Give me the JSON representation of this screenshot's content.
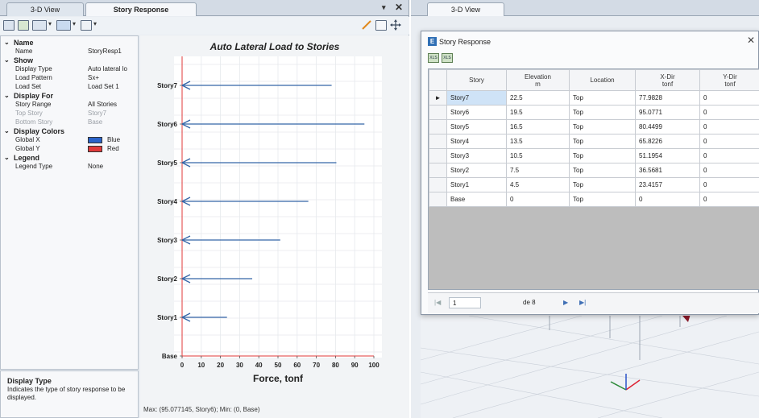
{
  "left_tabs": [
    "3-D View",
    "Story Response"
  ],
  "left_tab_ctl": [
    "▾",
    "✕"
  ],
  "right_tabs": [
    "3-D View"
  ],
  "props": {
    "name_cat": "Name",
    "name_key": "Name",
    "name_val": "StoryResp1",
    "show_cat": "Show",
    "display_type_key": "Display Type",
    "display_type_val": "Auto lateral lo",
    "load_pattern_key": "Load Pattern",
    "load_pattern_val": "Sx+",
    "load_set_key": "Load Set",
    "load_set_val": "Load Set 1",
    "display_for_cat": "Display For",
    "story_range_key": "Story Range",
    "story_range_val": "All Stories",
    "top_story_key": "Top Story",
    "top_story_val": "Story7",
    "bottom_story_key": "Bottom Story",
    "bottom_story_val": "Base",
    "display_colors_cat": "Display Colors",
    "global_x_key": "Global X",
    "global_x_val": "Blue",
    "global_x_color": "#2a63c9",
    "global_y_key": "Global Y",
    "global_y_val": "Red",
    "global_y_color": "#e03a3a",
    "legend_cat": "Legend",
    "legend_type_key": "Legend Type",
    "legend_type_val": "None"
  },
  "desc": {
    "title": "Display Type",
    "text": "Indicates the type of story response to be displayed."
  },
  "chart_data": {
    "type": "bar",
    "orientation": "horizontal",
    "title": "Auto Lateral Load to Stories",
    "xlabel": "Force, tonf",
    "ylabel": "",
    "categories": [
      "Base",
      "Story1",
      "Story2",
      "Story3",
      "Story4",
      "Story5",
      "Story6",
      "Story7"
    ],
    "values": [
      0,
      23.4157,
      36.5681,
      51.1954,
      65.8226,
      80.4499,
      95.0771,
      77.9828
    ],
    "xlim": [
      0,
      100
    ],
    "xticks": [
      "0",
      "10",
      "20",
      "30",
      "40",
      "50",
      "60",
      "70",
      "80",
      "90",
      "100"
    ],
    "grid": true,
    "series_color": "#3566a8",
    "axis_color": "#e03a3a",
    "status": "Max: (95.077145, Story6);   Min: (0, Base)"
  },
  "popup": {
    "title": "Story Response",
    "logo": "E",
    "close": "✕",
    "export_icons": [
      "XLS",
      "XLS"
    ],
    "columns": [
      {
        "line1": "Story",
        "line2": ""
      },
      {
        "line1": "Elevation",
        "line2": "m"
      },
      {
        "line1": "Location",
        "line2": ""
      },
      {
        "line1": "X-Dir",
        "line2": "tonf"
      },
      {
        "line1": "Y-Dir",
        "line2": "tonf"
      }
    ],
    "rows": [
      [
        "Story7",
        "22.5",
        "Top",
        "77.9828",
        "0"
      ],
      [
        "Story6",
        "19.5",
        "Top",
        "95.0771",
        "0"
      ],
      [
        "Story5",
        "16.5",
        "Top",
        "80.4499",
        "0"
      ],
      [
        "Story4",
        "13.5",
        "Top",
        "65.8226",
        "0"
      ],
      [
        "Story3",
        "10.5",
        "Top",
        "51.1954",
        "0"
      ],
      [
        "Story2",
        "7.5",
        "Top",
        "36.5681",
        "0"
      ],
      [
        "Story1",
        "4.5",
        "Top",
        "23.4157",
        "0"
      ],
      [
        "Base",
        "0",
        "Top",
        "0",
        "0"
      ]
    ],
    "current_row_marker": "►",
    "pager": {
      "first": "|◀",
      "prev": "◀",
      "page": "1",
      "of_label": "de 8",
      "next": "▶",
      "last": "▶|"
    }
  }
}
